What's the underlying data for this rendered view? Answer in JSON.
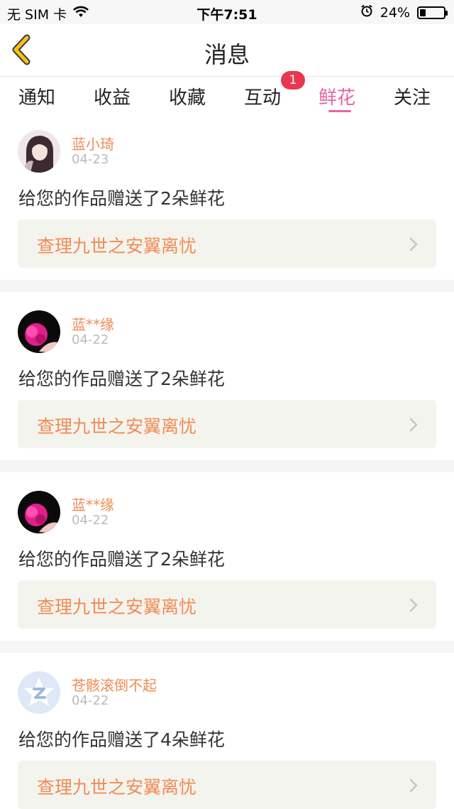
{
  "status_bar": {
    "carrier": "无 SIM 卡",
    "time": "下午7:51",
    "battery_percent": "24%",
    "battery_level": 0.24
  },
  "header": {
    "title": "消息"
  },
  "tabs": [
    {
      "label": "通知"
    },
    {
      "label": "收益"
    },
    {
      "label": "收藏"
    },
    {
      "label": "互动",
      "badge": "1"
    },
    {
      "label": "鲜花",
      "active": true
    },
    {
      "label": "关注"
    }
  ],
  "messages": [
    {
      "user": "蓝小琦",
      "date": "04-23",
      "text": "给您的作品赠送了2朵鲜花",
      "work": "查理九世之安翼离忧"
    },
    {
      "user": "蓝**缘",
      "date": "04-22",
      "text": "给您的作品赠送了2朵鲜花",
      "work": "查理九世之安翼离忧"
    },
    {
      "user": "蓝**缘",
      "date": "04-22",
      "text": "给您的作品赠送了2朵鲜花",
      "work": "查理九世之安翼离忧"
    },
    {
      "user": "苍骸滚倒不起",
      "date": "04-22",
      "text": "给您的作品赠送了4朵鲜花",
      "work": "查理九世之安翼离忧"
    }
  ],
  "colors": {
    "accent": "#e565a3",
    "username": "#f08c55",
    "badge": "#e8384f"
  }
}
